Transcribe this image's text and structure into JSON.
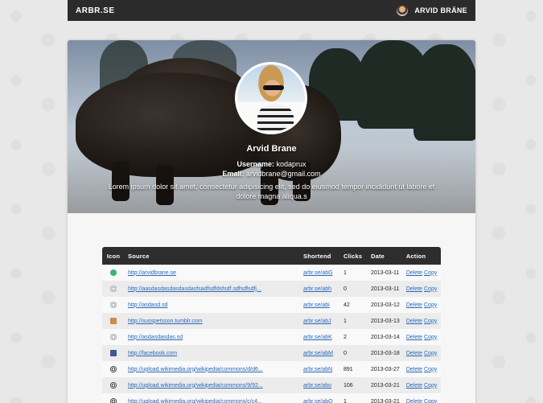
{
  "topbar": {
    "logo": "ARBR.SE",
    "user_name": "ARVID BRÄNE"
  },
  "profile": {
    "name": "Arvid Brane",
    "username_label": "Username:",
    "username": "kodaprux",
    "email_label": "Email:",
    "email": "arvidbrane@gmail.com",
    "bio": "Lorem ipsum dolor sit amet, consectetur adipisicing elit, sed do eiusmod tempor incididunt ut labore et dolore magna aliqua.s"
  },
  "table": {
    "headers": [
      "Icon",
      "Source",
      "Shortend",
      "Clicks",
      "Date",
      "Action"
    ],
    "delete_label": "Delete",
    "copy_label": "Copy",
    "rows": [
      {
        "icon": "green-chat-icon",
        "source": "http://arvidbrane.se",
        "short": "arbr.se/abG",
        "clicks": "1",
        "date": "2013-03-11"
      },
      {
        "icon": "globe-icon",
        "source": "http://aasdasdasdasdasdasfsadfsdfdsfsdf.sdfsdfsdfj...",
        "short": "arbr.se/abh",
        "clicks": "0",
        "date": "2013-03-11"
      },
      {
        "icon": "globe-icon",
        "source": "http://asdasd.sd",
        "short": "arbr.se/abi",
        "clicks": "42",
        "date": "2013-03-12"
      },
      {
        "icon": "tumblr-icon",
        "source": "http://susspetsson.tumblr.com",
        "short": "arbr.se/abJ",
        "clicks": "1",
        "date": "2013-03-13"
      },
      {
        "icon": "globe-icon",
        "source": "http://asdasdasdas.sd",
        "short": "arbr.se/abK",
        "clicks": "2",
        "date": "2013-03-14"
      },
      {
        "icon": "facebook-icon",
        "source": "http://facebook.com",
        "short": "arbr.se/abM",
        "clicks": "0",
        "date": "2013-03-18"
      },
      {
        "icon": "wikipedia-icon",
        "source": "http://upload.wikimedia.org/wikipedia/commons/d/d6...",
        "short": "arbr.se/abN",
        "clicks": "891",
        "date": "2013-03-27"
      },
      {
        "icon": "wikipedia-icon",
        "source": "http://upload.wikimedia.org/wikipedia/commons/9/92...",
        "short": "arbr.se/abo",
        "clicks": "106",
        "date": "2013-03-21"
      },
      {
        "icon": "wikipedia-icon",
        "source": "http://upload.wikimedia.org/wikipedia/commons/c/c4...",
        "short": "arbr.se/abQ",
        "clicks": "1",
        "date": "2013-03-21"
      }
    ]
  }
}
